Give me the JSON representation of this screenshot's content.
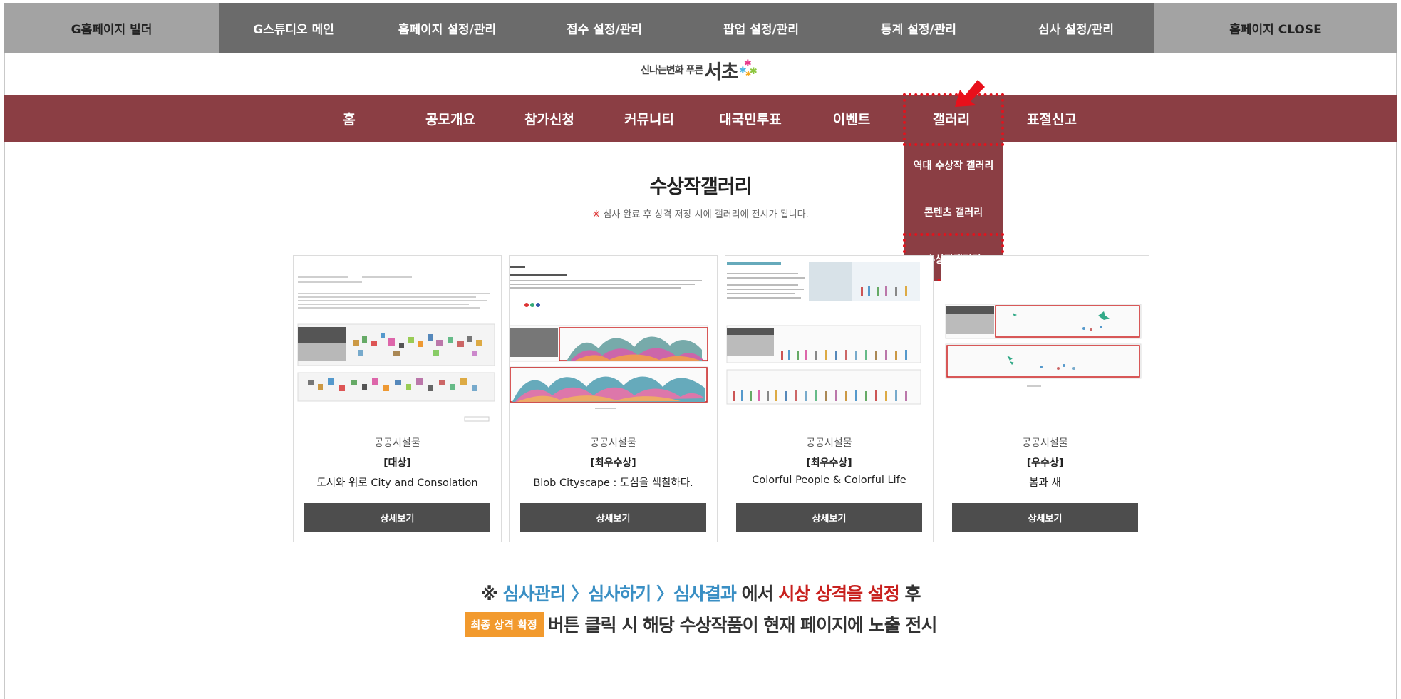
{
  "admin_bar": {
    "items": [
      "G홈페이지 빌더",
      "G스튜디오 메인",
      "홈페이지 설정/관리",
      "접수 설정/관리",
      "팝업 설정/관리",
      "통계 설정/관리",
      "심사 설정/관리",
      "홈페이지 CLOSE"
    ]
  },
  "logo": {
    "small_text": "신나는변화 푸른",
    "big_text": "서초",
    "star_colors": [
      "#e83a8c",
      "#4bb7e5",
      "#8cc63f",
      "#f7a81b"
    ]
  },
  "main_nav": {
    "items": [
      "홈",
      "공모개요",
      "참가신청",
      "커뮤니티",
      "대국민투표",
      "이벤트",
      "갤러리",
      "표절신고"
    ],
    "active": "갤러리"
  },
  "gallery_dropdown": {
    "items": [
      "역대 수상작 갤러리",
      "콘텐츠 갤러리",
      "수상작갤러리"
    ],
    "highlighted": "수상작갤러리"
  },
  "colors": {
    "admin_bar_bg": "#6b6b6b",
    "nav_bg": "#8b3e44",
    "highlight": "#e0141e",
    "button_bg": "#4d4d4d",
    "badge_bg": "#f29a2e",
    "guide_blue": "#3a8fc4",
    "guide_red": "#c8201e"
  },
  "page": {
    "title": "수상작갤러리",
    "notice_mark": "※",
    "notice_text": "심사 완료 후 상격 저장 시에 갤러리에 전시가 됩니다."
  },
  "cards": [
    {
      "category": "공공시설물",
      "award": "[대상]",
      "name": "도시와 위로 City and Consolation",
      "button": "상세보기"
    },
    {
      "category": "공공시설물",
      "award": "[최우수상]",
      "name": "Blob Cityscape : 도심을 색칠하다.",
      "button": "상세보기"
    },
    {
      "category": "공공시설물",
      "award": "[최우수상]",
      "name": "Colorful People & Colorful Life",
      "button": "상세보기"
    },
    {
      "category": "공공시설물",
      "award": "[우수상]",
      "name": "봄과 새",
      "button": "상세보기"
    }
  ],
  "guide": {
    "line1_mark": "※",
    "line1_path": "심사관리 〉심사하기 〉심사결과",
    "line1_mid": "에서",
    "line1_red": "시상 상격을 설정",
    "line1_end": "후",
    "badge": "최종 상격 확정",
    "line2_text": "버튼 클릭 시 해당 수상작품이 현재 페이지에 노출 전시"
  }
}
